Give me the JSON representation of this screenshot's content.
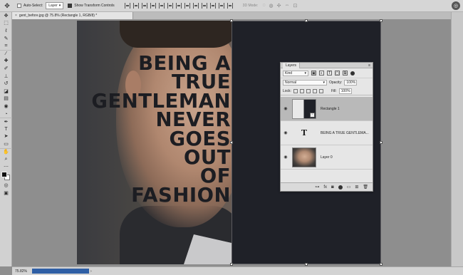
{
  "options_bar": {
    "move_icon": "move-tool-icon",
    "auto_select_label": "Auto-Select:",
    "auto_select_target": "Layer",
    "show_transform_label": "Show Transform Controls",
    "mode_3d_label": "3D Mode:"
  },
  "document": {
    "tab_title": "gent_before.jpg @ 75.8% (Rectangle 1, RGB/8) *",
    "close_glyph": "×",
    "headline": "BEING A\nTRUE\nGENTLEMAN\nNEVER\nGOES\nOUT\nOF\nFASHION",
    "colors": {
      "dark_overlay": "#1f2128",
      "text": "#1c1d22"
    }
  },
  "tools": [
    {
      "name": "move-tool",
      "glyph": "✥"
    },
    {
      "name": "marquee-tool",
      "glyph": "⬚"
    },
    {
      "name": "lasso-tool",
      "glyph": "ℓ"
    },
    {
      "name": "quick-select-tool",
      "glyph": "✎"
    },
    {
      "name": "crop-tool",
      "glyph": "⌗"
    },
    {
      "name": "eyedropper-tool",
      "glyph": "⁄"
    },
    {
      "name": "healing-tool",
      "glyph": "✚"
    },
    {
      "name": "brush-tool",
      "glyph": "✐"
    },
    {
      "name": "clone-stamp-tool",
      "glyph": "⊥"
    },
    {
      "name": "history-brush-tool",
      "glyph": "↺"
    },
    {
      "name": "eraser-tool",
      "glyph": "◪"
    },
    {
      "name": "gradient-tool",
      "glyph": "▤"
    },
    {
      "name": "blur-tool",
      "glyph": "◉"
    },
    {
      "name": "dodge-tool",
      "glyph": "◔"
    },
    {
      "name": "pen-tool",
      "glyph": "✒"
    },
    {
      "name": "type-tool",
      "glyph": "T"
    },
    {
      "name": "path-select-tool",
      "glyph": "➤"
    },
    {
      "name": "shape-tool",
      "glyph": "▭"
    },
    {
      "name": "hand-tool",
      "glyph": "✋"
    },
    {
      "name": "zoom-tool",
      "glyph": "⌕"
    },
    {
      "name": "more-tools",
      "glyph": "⋯"
    }
  ],
  "tools_bottom": [
    {
      "name": "quick-mask-tool",
      "glyph": "◎"
    },
    {
      "name": "screen-mode-tool",
      "glyph": "▣"
    }
  ],
  "layers_panel": {
    "title": "Layers",
    "filter_kind": "Kind",
    "blend_mode": "Normal",
    "opacity_label": "Opacity:",
    "opacity_value": "100%",
    "lock_label": "Lock:",
    "fill_label": "Fill:",
    "fill_value": "100%",
    "layers": [
      {
        "name": "Rectangle 1",
        "type": "shape",
        "selected": true
      },
      {
        "name": "BEING A TRUE GENTLEMA...",
        "type": "text",
        "selected": false
      },
      {
        "name": "Layer 0",
        "type": "image",
        "selected": false
      }
    ]
  },
  "status_bar": {
    "zoom": "75.82%",
    "progress": 1.0,
    "arrow": "›"
  }
}
